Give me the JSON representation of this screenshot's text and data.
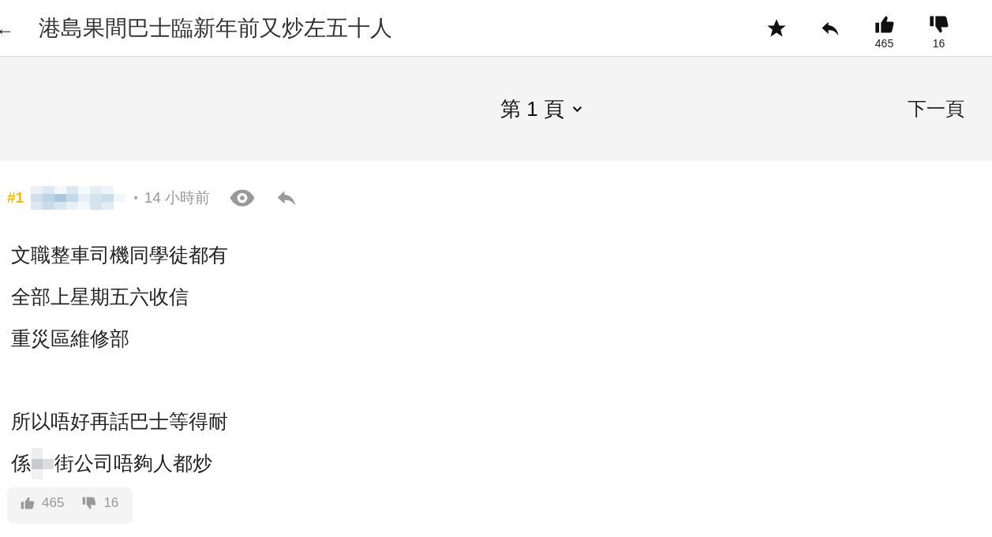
{
  "header": {
    "back": "←",
    "title": "港島果間巴士臨新年前又炒左五十人",
    "like_count": "465",
    "dislike_count": "16"
  },
  "pager": {
    "page_label": "第 1 頁",
    "next": "下一頁"
  },
  "post": {
    "number": "#1",
    "author_redacted": true,
    "separator": "•",
    "time": "14 小時前",
    "paragraphs": [
      [
        [
          {
            "kind": "text",
            "text": "文職整車司機同學徒都有"
          }
        ],
        [
          {
            "kind": "text",
            "text": "全部上星期五六收信"
          }
        ],
        [
          {
            "kind": "text",
            "text": "重災區維修部"
          }
        ]
      ],
      [
        [
          {
            "kind": "text",
            "text": "所以唔好再話巴士等得耐"
          }
        ],
        [
          {
            "kind": "text",
            "text": "係"
          },
          {
            "kind": "redaction"
          },
          {
            "kind": "text",
            "text": "街公司唔夠人都炒"
          }
        ]
      ]
    ],
    "likes": "465",
    "dislikes": "16"
  }
}
